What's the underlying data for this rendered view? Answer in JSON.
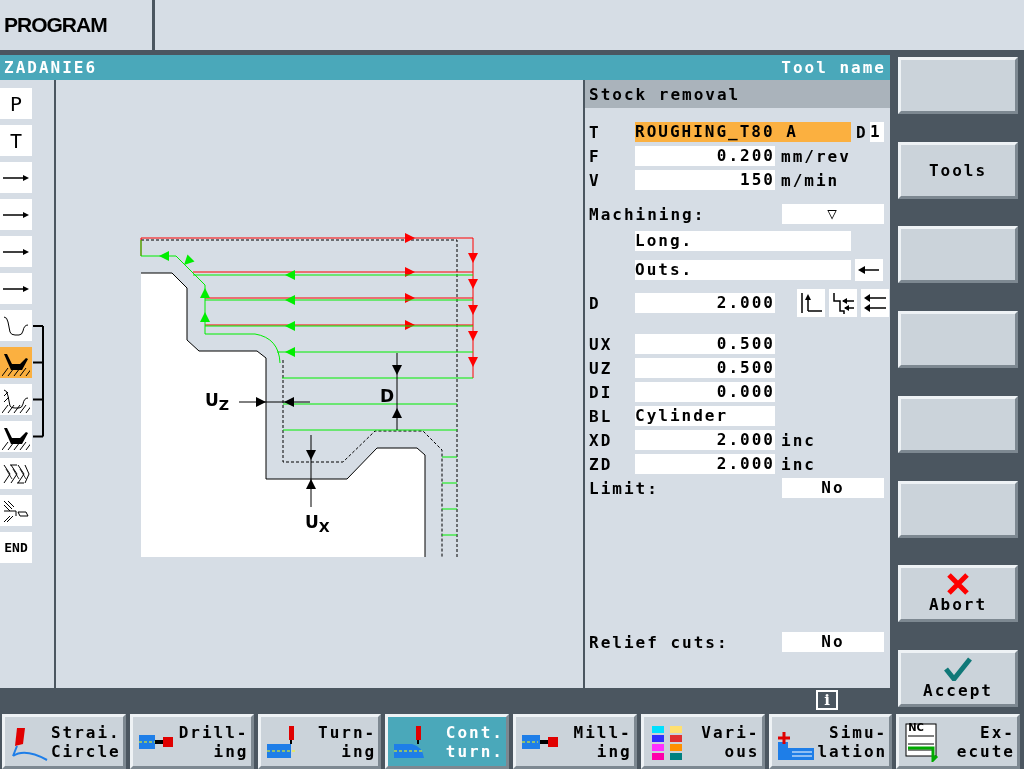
{
  "header": {
    "title": "PROGRAM"
  },
  "window": {
    "title": "ZADANIE6",
    "tool_label": "Tool name"
  },
  "strip": [
    {
      "kind": "letter",
      "label": "P",
      "selected": false,
      "grouped": false
    },
    {
      "kind": "letter",
      "label": "T",
      "selected": false,
      "grouped": false
    },
    {
      "kind": "arrow",
      "selected": false,
      "grouped": false
    },
    {
      "kind": "arrow",
      "selected": false,
      "grouped": false
    },
    {
      "kind": "arrow",
      "selected": false,
      "grouped": false
    },
    {
      "kind": "arrow",
      "selected": false,
      "grouped": false
    },
    {
      "kind": "contour",
      "selected": false,
      "grouped": true
    },
    {
      "kind": "pocket-filled",
      "selected": true,
      "grouped": true
    },
    {
      "kind": "pocket-hatched",
      "selected": false,
      "grouped": true
    },
    {
      "kind": "pocket-filled",
      "selected": false,
      "grouped": true
    },
    {
      "kind": "thread",
      "selected": false,
      "grouped": false
    },
    {
      "kind": "parting",
      "selected": false,
      "grouped": false
    },
    {
      "kind": "letter",
      "label": "END",
      "selected": false,
      "grouped": false
    }
  ],
  "diagram": {
    "labels": [
      {
        "kind": "uz",
        "text": "U$_{Z}$"
      },
      {
        "kind": "d",
        "text": "D"
      },
      {
        "kind": "ux",
        "text": "U$_{X}$"
      }
    ]
  },
  "form": {
    "title": "Stock removal",
    "sections": [
      [
        {
          "kind": "tool",
          "label": "T",
          "value": "ROUGHING_T80 A",
          "highlighted": true,
          "extra_label": "D",
          "extra_value": "1"
        },
        {
          "kind": "number",
          "label": "F",
          "value": "0.200",
          "unit": "mm/rev"
        },
        {
          "kind": "number",
          "label": "V",
          "value": "150",
          "unit": "m/min"
        }
      ],
      [
        {
          "kind": "toggle",
          "label": "Machining:",
          "value": "▽"
        },
        {
          "kind": "choice",
          "value": "Long."
        },
        {
          "kind": "choice-arrow",
          "value": "Outs."
        },
        {
          "kind": "depth",
          "label": "D",
          "value": "2.000"
        }
      ],
      [
        {
          "kind": "number",
          "label": "UX",
          "value": "0.500"
        },
        {
          "kind": "number",
          "label": "UZ",
          "value": "0.500"
        },
        {
          "kind": "number",
          "label": "DI",
          "value": "0.000"
        },
        {
          "kind": "text",
          "label": "BL",
          "value": "Cylinder"
        },
        {
          "kind": "number",
          "label": "XD",
          "value": "2.000",
          "unit": "inc"
        },
        {
          "kind": "number",
          "label": "ZD",
          "value": "2.000",
          "unit": "inc"
        },
        {
          "kind": "toggle",
          "label": "Limit:",
          "value": "No"
        }
      ],
      [
        {
          "kind": "toggle",
          "label": "Relief cuts:",
          "value": "No"
        }
      ]
    ]
  },
  "info_key": "i",
  "side_keys": [
    {
      "kind": "empty"
    },
    {
      "kind": "label",
      "label": "Tools"
    },
    {
      "kind": "empty"
    },
    {
      "kind": "empty"
    },
    {
      "kind": "empty"
    },
    {
      "kind": "empty"
    },
    {
      "kind": "abort",
      "label": "Abort"
    },
    {
      "kind": "accept",
      "label": "Accept"
    }
  ],
  "bottom_keys": [
    {
      "kind": "line-circle",
      "label": "Strai.\nCircle",
      "selected": false
    },
    {
      "kind": "drilling",
      "label": "Drill-\ning",
      "selected": false
    },
    {
      "kind": "turning",
      "label": "Turn-\ning",
      "selected": false
    },
    {
      "kind": "contour-turning",
      "label": "Cont.\nturn.",
      "selected": true
    },
    {
      "kind": "milling",
      "label": "Mill-\ning",
      "selected": false
    },
    {
      "kind": "various",
      "label": "Vari-\nous",
      "selected": false
    },
    {
      "kind": "simulation",
      "label": "Simu-\nlation",
      "selected": false
    },
    {
      "kind": "execute",
      "label": "Ex-\necute",
      "selected": false,
      "icon_text": "NC"
    }
  ]
}
